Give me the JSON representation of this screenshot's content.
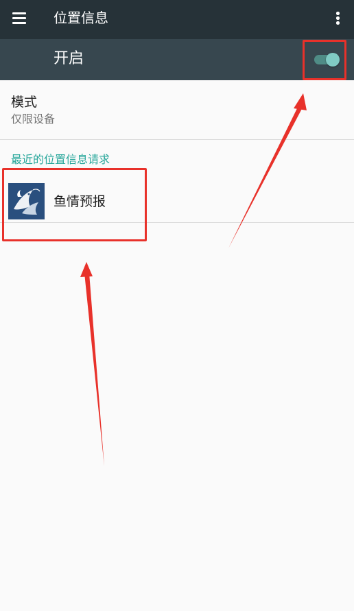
{
  "app_bar": {
    "title": "位置信息",
    "menu_icon": "hamburger-menu-icon",
    "overflow_icon": "more-vert-icon"
  },
  "master_switch": {
    "label": "开启",
    "state": "on"
  },
  "mode": {
    "title": "模式",
    "value": "仅限设备"
  },
  "recent_requests": {
    "header": "最近的位置信息请求",
    "items": [
      {
        "name": "鱼情预报",
        "icon": "fishing-forecast-app-icon"
      }
    ]
  },
  "colors": {
    "app_bar": "#263238",
    "switch_bar": "#37474f",
    "accent": "#26a69a",
    "toggle_thumb": "#80cbc4",
    "annotation": "#e8312a"
  }
}
